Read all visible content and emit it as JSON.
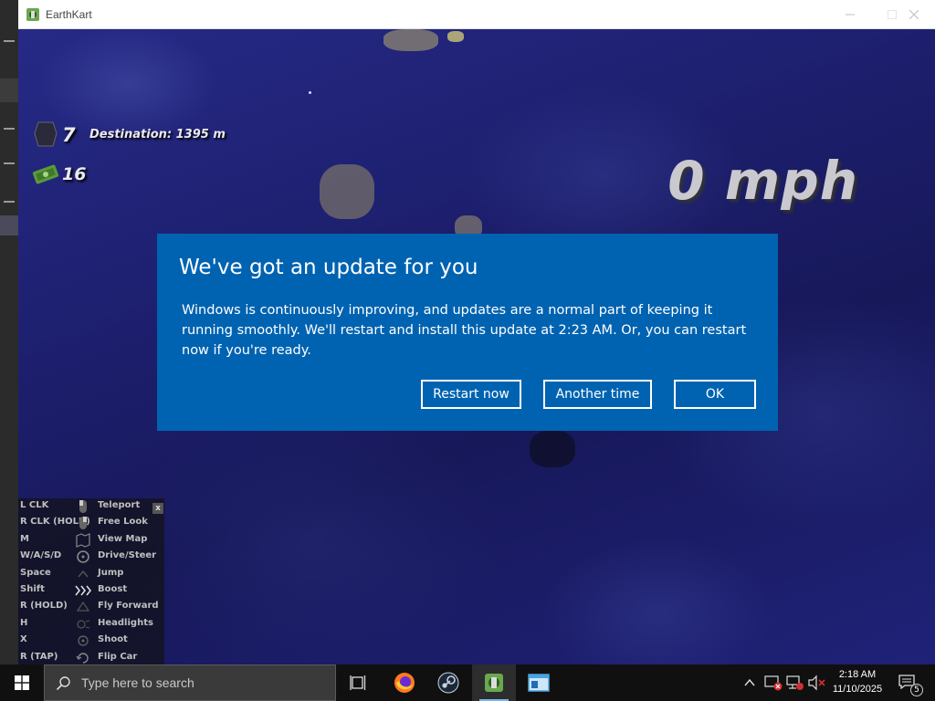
{
  "window": {
    "title": "EarthKart",
    "minimize_icon": "minimize-icon",
    "maximize_icon": "maximize-icon",
    "close_icon": "close-icon"
  },
  "hud": {
    "counter_value": "7",
    "destination_text": "Destination: 1395 m",
    "cash_value": "16",
    "speed_text": "0 mph"
  },
  "controls": {
    "close_label": "x",
    "items": [
      {
        "key": "L CLK",
        "action": "Teleport",
        "icon": "mouse-left-icon"
      },
      {
        "key": "R CLK (HOLD)",
        "action": "Free Look",
        "icon": "mouse-right-icon"
      },
      {
        "key": "M",
        "action": "View Map",
        "icon": "map-icon"
      },
      {
        "key": "W/A/S/D",
        "action": "Drive/Steer",
        "icon": "steering-icon"
      },
      {
        "key": "Space",
        "action": "Jump",
        "icon": "jump-icon"
      },
      {
        "key": "Shift",
        "action": "Boost",
        "icon": "boost-chevrons-icon"
      },
      {
        "key": "R (HOLD)",
        "action": "Fly Forward",
        "icon": "fly-icon"
      },
      {
        "key": "H",
        "action": "Headlights",
        "icon": "headlight-icon"
      },
      {
        "key": "X",
        "action": "Shoot",
        "icon": "shoot-icon"
      },
      {
        "key": "R (TAP)",
        "action": "Flip Car",
        "icon": "flip-icon"
      }
    ]
  },
  "dialog": {
    "heading": "We've got an update for you",
    "body": "Windows is continuously improving, and updates are a normal part of keeping it running smoothly. We'll restart and install this update at 2:23 AM. Or, you can restart now if you're ready.",
    "restart_now_label": "Restart now",
    "another_time_label": "Another time",
    "ok_label": "OK",
    "background_color": "#0063b1"
  },
  "taskbar": {
    "search_placeholder": "Type here to search",
    "time": "2:18 AM",
    "date": "11/10/2025",
    "notification_count": "5"
  }
}
